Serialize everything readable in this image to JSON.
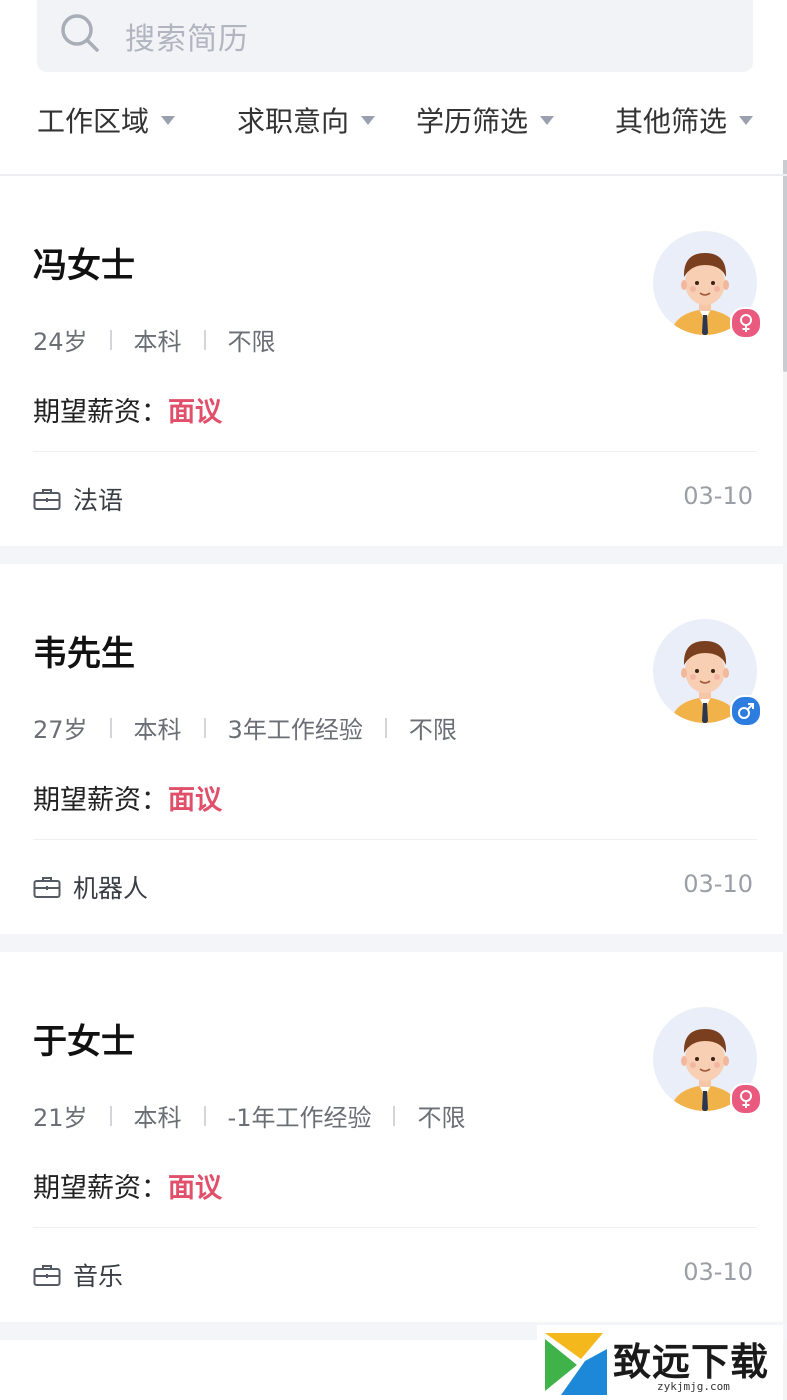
{
  "search": {
    "placeholder": "搜索简历",
    "icon": "search-icon"
  },
  "filters": [
    {
      "label": "工作区域",
      "icon": "caret-down-icon"
    },
    {
      "label": "求职意向",
      "icon": "caret-down-icon"
    },
    {
      "label": "学历筛选",
      "icon": "caret-down-icon"
    },
    {
      "label": "其他筛选",
      "icon": "caret-down-icon"
    }
  ],
  "resumes": [
    {
      "name": "冯女士",
      "meta": [
        "24岁",
        "本科",
        "不限"
      ],
      "salary_label": "期望薪资：",
      "salary_value": "面议",
      "job": "法语",
      "date": "03-10",
      "gender": "female"
    },
    {
      "name": "韦先生",
      "meta": [
        "27岁",
        "本科",
        "3年工作经验",
        "不限"
      ],
      "salary_label": "期望薪资：",
      "salary_value": "面议",
      "job": "机器人",
      "date": "03-10",
      "gender": "male"
    },
    {
      "name": "于女士",
      "meta": [
        "21岁",
        "本科",
        "-1年工作经验",
        "不限"
      ],
      "salary_label": "期望薪资：",
      "salary_value": "面议",
      "job": "音乐",
      "date": "03-10",
      "gender": "female"
    }
  ],
  "watermark": {
    "title": "致远下载",
    "url": "zykjmjg.com"
  },
  "colors": {
    "accent_salary": "#e0506b",
    "female_badge": "#e95a7e",
    "male_badge": "#2d7ce0",
    "page_gap": "#f3f5f8"
  }
}
